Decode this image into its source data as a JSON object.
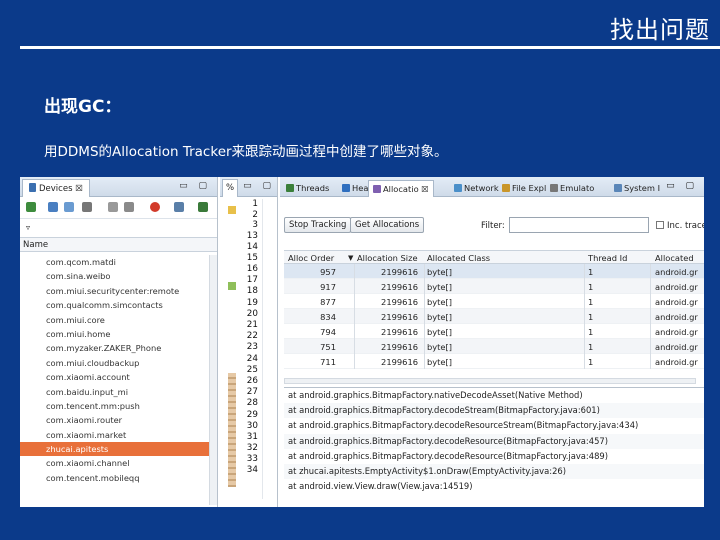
{
  "slide": {
    "header": "找出问题",
    "heading": "出现GC：",
    "subtext": "用DDMS的Allocation Tracker来跟踪动画过程中创建了哪些对象。"
  },
  "devices_panel": {
    "tab_label": "Devices ☒",
    "column_name": "Name",
    "rows": [
      "com.qcom.matdi",
      "com.sina.weibo",
      "com.miui.securitycenter:remote",
      "com.qualcomm.simcontacts",
      "com.miui.core",
      "com.miui.home",
      "com.myzaker.ZAKER_Phone",
      "com.miui.cloudbackup",
      "com.xiaomi.account",
      "com.baidu.input_mi",
      "com.tencent.mm:push",
      "com.xiaomi.router",
      "com.xiaomi.market",
      "zhucai.apitests",
      "com.xiaomi.channel",
      "com.tencent.mobileqq"
    ],
    "selected_index": 13
  },
  "line_numbers": {
    "tab_label": "%",
    "numbers": [
      "1",
      "2",
      "3",
      "13",
      "14",
      "15",
      "16",
      "17",
      "18",
      "19",
      "20",
      "21",
      "22",
      "23",
      "24",
      "25",
      "26",
      "27",
      "28",
      "29",
      "30",
      "31",
      "32",
      "33",
      "34"
    ]
  },
  "alloc_panel": {
    "tabs": [
      {
        "label": "Threads",
        "color": "#3a7f3a"
      },
      {
        "label": "Heap",
        "color": "#2f6fbf"
      },
      {
        "label": "Allocatio ☒",
        "color": "#7f5fb0"
      },
      {
        "label": "Network",
        "color": "#4a8fc9"
      },
      {
        "label": "File Expl",
        "color": "#c9962a"
      },
      {
        "label": "Emulato",
        "color": "#777777"
      },
      {
        "label": "System I",
        "color": "#5a86b8"
      }
    ],
    "stop_button": "Stop Tracking",
    "get_button": "Get Allocations",
    "filter_label": "Filter:",
    "inc_trace_label": "Inc. trace",
    "columns": [
      "Alloc Order",
      "Allocation Size",
      "Allocated Class",
      "Thread Id",
      "Allocated"
    ],
    "rows": [
      {
        "order": "957",
        "size": "2199616",
        "class": "byte[]",
        "thread": "1",
        "allocated": "android.gr"
      },
      {
        "order": "917",
        "size": "2199616",
        "class": "byte[]",
        "thread": "1",
        "allocated": "android.gr"
      },
      {
        "order": "877",
        "size": "2199616",
        "class": "byte[]",
        "thread": "1",
        "allocated": "android.gr"
      },
      {
        "order": "834",
        "size": "2199616",
        "class": "byte[]",
        "thread": "1",
        "allocated": "android.gr"
      },
      {
        "order": "794",
        "size": "2199616",
        "class": "byte[]",
        "thread": "1",
        "allocated": "android.gr"
      },
      {
        "order": "751",
        "size": "2199616",
        "class": "byte[]",
        "thread": "1",
        "allocated": "android.gr"
      },
      {
        "order": "711",
        "size": "2199616",
        "class": "byte[]",
        "thread": "1",
        "allocated": "android.gr"
      }
    ],
    "stack_trace": [
      "at android.graphics.BitmapFactory.nativeDecodeAsset(Native Method)",
      "at android.graphics.BitmapFactory.decodeStream(BitmapFactory.java:601)",
      "at android.graphics.BitmapFactory.decodeResourceStream(BitmapFactory.java:434)",
      "at android.graphics.BitmapFactory.decodeResource(BitmapFactory.java:457)",
      "at android.graphics.BitmapFactory.decodeResource(BitmapFactory.java:489)",
      "at zhucai.apitests.EmptyActivity$1.onDraw(EmptyActivity.java:26)",
      "at android.view.View.draw(View.java:14519)"
    ]
  }
}
